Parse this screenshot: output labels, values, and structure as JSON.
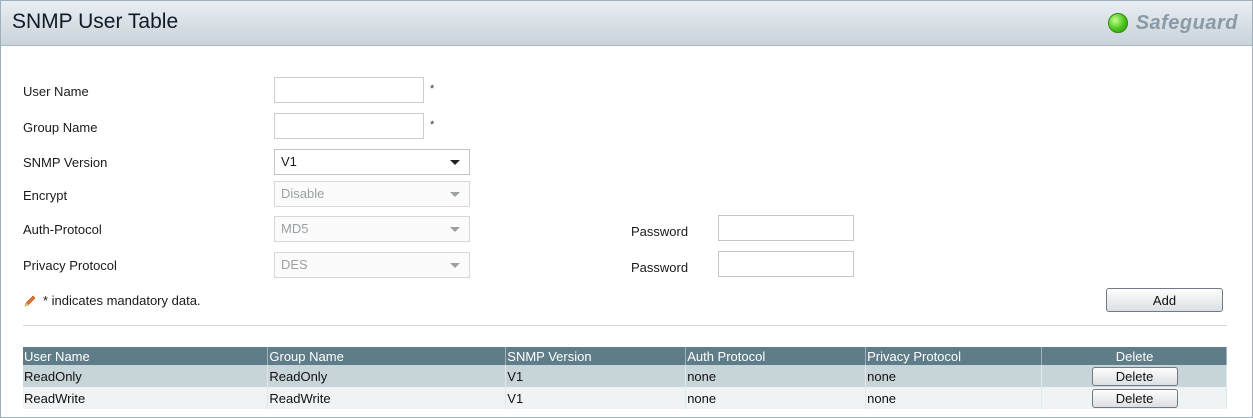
{
  "header": {
    "title": "SNMP User Table",
    "safeguard": "Safeguard"
  },
  "form": {
    "user_name_label": "User Name",
    "user_name_value": "",
    "group_name_label": "Group Name",
    "group_name_value": "",
    "required_mark": "*",
    "snmp_version_label": "SNMP Version",
    "snmp_version_value": "V1",
    "encrypt_label": "Encrypt",
    "encrypt_value": "Disable",
    "auth_protocol_label": "Auth-Protocol",
    "auth_protocol_value": "MD5",
    "privacy_protocol_label": "Privacy Protocol",
    "privacy_protocol_value": "DES",
    "password_label": "Password",
    "note": "* indicates mandatory data.",
    "add_label": "Add"
  },
  "table": {
    "columns": [
      "User Name",
      "Group Name",
      "SNMP Version",
      "Auth Protocol",
      "Privacy Protocol",
      "Delete"
    ],
    "rows": [
      {
        "user": "ReadOnly",
        "group": "ReadOnly",
        "version": "V1",
        "auth": "none",
        "privacy": "none",
        "delete_label": "Delete"
      },
      {
        "user": "ReadWrite",
        "group": "ReadWrite",
        "version": "V1",
        "auth": "none",
        "privacy": "none",
        "delete_label": "Delete"
      }
    ]
  },
  "colors": {
    "header_bg": "#c9d3da",
    "table_header": "#5f7d88",
    "row_alt": "#c7d5d9",
    "status_green": "#48c41c"
  },
  "icons": {
    "safeguard": "status-green-dot-icon",
    "note": "pencil-icon"
  }
}
